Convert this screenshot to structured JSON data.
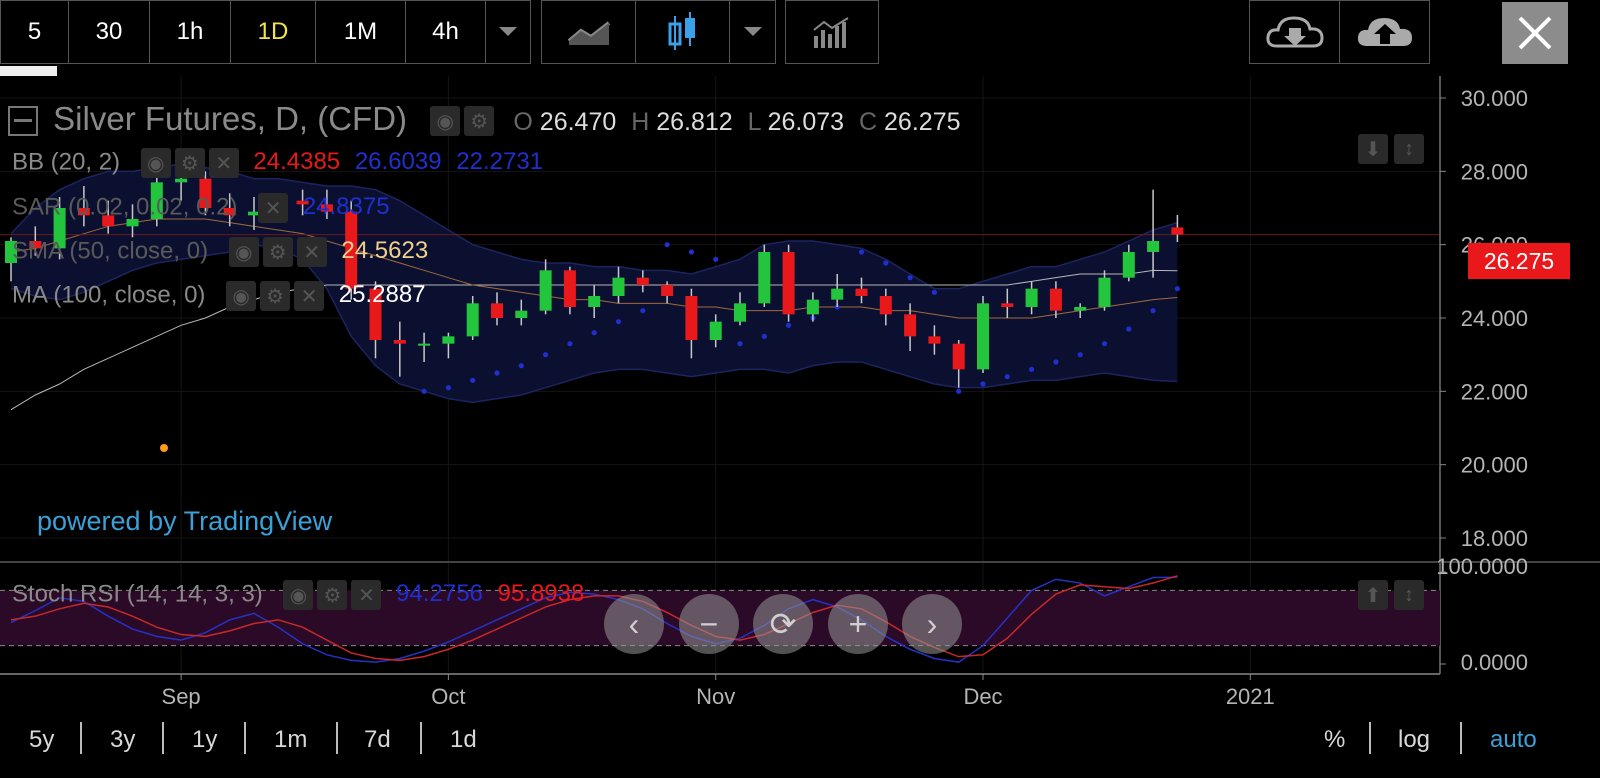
{
  "toolbar": {
    "intervals": [
      "5",
      "30",
      "1h",
      "1D",
      "1M",
      "4h"
    ],
    "active_interval": "1D",
    "chart_style_icons": [
      "line-chart-icon",
      "candlestick-icon",
      "indicators-icon"
    ],
    "cloud_download_icon": "cloud-download-icon",
    "cloud_upload_icon": "cloud-upload-icon",
    "close_icon": "close-icon"
  },
  "symbol": {
    "title": "Silver Futures, D, (CFD)",
    "o_label": "O",
    "o": "26.470",
    "h_label": "H",
    "h": "26.812",
    "l_label": "L",
    "l": "26.073",
    "c_label": "C",
    "c": "26.275"
  },
  "indicators": {
    "bb": {
      "label": "BB (20, 2)",
      "v1": "24.4385",
      "v2": "26.6039",
      "v3": "22.2731"
    },
    "sar": {
      "label": "SAR (0.02, 0.02, 0.2)",
      "v1": "24.8375"
    },
    "sma": {
      "label": "SMA (50, close, 0)",
      "v1": "24.5623"
    },
    "ma": {
      "label": "MA (100, close, 0)",
      "v1": "25.2887"
    },
    "stoch": {
      "label": "Stoch RSI (14, 14, 3, 3)",
      "v1": "94.2756",
      "v2": "95.8938"
    }
  },
  "watermark": "powered by TradingView",
  "colors": {
    "up": "#23c53d",
    "down": "#e8181b",
    "bb_fill": "#0c1030",
    "sar": "#1f2fd0",
    "stoch_fill": "#2a0a26",
    "stoch_k": "#2432c8",
    "stoch_d": "#c82828",
    "price_tag": "#e8181b",
    "sma": "#a06a3c",
    "ma": "#b8b8b8",
    "active_tf": "#f0e64c",
    "link": "#3ba0d8"
  },
  "nav_buttons": [
    "‹",
    "−",
    "⟳",
    "+",
    "›"
  ],
  "timeframes": [
    "5y",
    "3y",
    "1y",
    "1m",
    "7d",
    "1d"
  ],
  "scale_options": [
    "%",
    "log",
    "auto"
  ],
  "chart_data": {
    "type": "candlestick",
    "title": "Silver Futures, D, (CFD)",
    "ylim": [
      17.4,
      30.6
    ],
    "y_ticks": [
      "30.000",
      "28.000",
      "26.000",
      "24.000",
      "22.000",
      "20.000",
      "18.000"
    ],
    "y_tick_values": [
      30,
      28,
      26,
      24,
      22,
      20,
      18
    ],
    "x_ticks": [
      "Sep",
      "Oct",
      "Nov",
      "Dec",
      "2021"
    ],
    "x_tick_bar_index": [
      7,
      18,
      29,
      40,
      51
    ],
    "last_price": "26.275",
    "candles": [
      {
        "o": 25.5,
        "h": 26.2,
        "l": 25.0,
        "c": 26.1
      },
      {
        "o": 26.1,
        "h": 26.5,
        "l": 25.7,
        "c": 25.9
      },
      {
        "o": 25.9,
        "h": 27.3,
        "l": 25.6,
        "c": 27.0
      },
      {
        "o": 27.0,
        "h": 27.6,
        "l": 26.5,
        "c": 26.8
      },
      {
        "o": 26.8,
        "h": 27.2,
        "l": 26.3,
        "c": 26.5
      },
      {
        "o": 26.5,
        "h": 27.1,
        "l": 26.2,
        "c": 26.7
      },
      {
        "o": 26.7,
        "h": 28.0,
        "l": 26.5,
        "c": 27.7
      },
      {
        "o": 27.7,
        "h": 28.3,
        "l": 27.2,
        "c": 27.8
      },
      {
        "o": 27.8,
        "h": 28.0,
        "l": 26.8,
        "c": 27.0
      },
      {
        "o": 27.0,
        "h": 27.4,
        "l": 26.5,
        "c": 26.8
      },
      {
        "o": 26.8,
        "h": 27.3,
        "l": 26.4,
        "c": 26.9
      },
      {
        "o": 26.9,
        "h": 27.4,
        "l": 26.6,
        "c": 27.2
      },
      {
        "o": 27.2,
        "h": 27.5,
        "l": 26.8,
        "c": 27.1
      },
      {
        "o": 27.1,
        "h": 27.5,
        "l": 26.7,
        "c": 26.9
      },
      {
        "o": 26.9,
        "h": 27.2,
        "l": 24.5,
        "c": 24.8
      },
      {
        "o": 24.8,
        "h": 25.0,
        "l": 22.9,
        "c": 23.4
      },
      {
        "o": 23.4,
        "h": 23.9,
        "l": 22.4,
        "c": 23.3
      },
      {
        "o": 23.3,
        "h": 23.6,
        "l": 22.8,
        "c": 23.3
      },
      {
        "o": 23.3,
        "h": 23.6,
        "l": 22.9,
        "c": 23.5
      },
      {
        "o": 23.5,
        "h": 24.6,
        "l": 23.4,
        "c": 24.4
      },
      {
        "o": 24.4,
        "h": 24.7,
        "l": 23.8,
        "c": 24.0
      },
      {
        "o": 24.0,
        "h": 24.5,
        "l": 23.8,
        "c": 24.2
      },
      {
        "o": 24.2,
        "h": 25.6,
        "l": 24.1,
        "c": 25.3
      },
      {
        "o": 25.3,
        "h": 25.4,
        "l": 24.1,
        "c": 24.3
      },
      {
        "o": 24.3,
        "h": 24.9,
        "l": 24.0,
        "c": 24.6
      },
      {
        "o": 24.6,
        "h": 25.4,
        "l": 24.4,
        "c": 25.1
      },
      {
        "o": 25.1,
        "h": 25.3,
        "l": 24.7,
        "c": 24.9
      },
      {
        "o": 24.9,
        "h": 25.0,
        "l": 24.4,
        "c": 24.6
      },
      {
        "o": 24.6,
        "h": 24.8,
        "l": 22.9,
        "c": 23.4
      },
      {
        "o": 23.4,
        "h": 24.1,
        "l": 23.2,
        "c": 23.9
      },
      {
        "o": 23.9,
        "h": 24.7,
        "l": 23.8,
        "c": 24.4
      },
      {
        "o": 24.4,
        "h": 26.0,
        "l": 24.3,
        "c": 25.8
      },
      {
        "o": 25.8,
        "h": 26.0,
        "l": 23.9,
        "c": 24.1
      },
      {
        "o": 24.1,
        "h": 24.7,
        "l": 23.9,
        "c": 24.5
      },
      {
        "o": 24.5,
        "h": 25.2,
        "l": 24.3,
        "c": 24.8
      },
      {
        "o": 24.8,
        "h": 25.1,
        "l": 24.4,
        "c": 24.6
      },
      {
        "o": 24.6,
        "h": 24.8,
        "l": 23.8,
        "c": 24.1
      },
      {
        "o": 24.1,
        "h": 24.4,
        "l": 23.1,
        "c": 23.5
      },
      {
        "o": 23.5,
        "h": 23.8,
        "l": 23.0,
        "c": 23.3
      },
      {
        "o": 23.3,
        "h": 23.4,
        "l": 22.1,
        "c": 22.6
      },
      {
        "o": 22.6,
        "h": 24.6,
        "l": 22.5,
        "c": 24.4
      },
      {
        "o": 24.4,
        "h": 24.8,
        "l": 24.0,
        "c": 24.3
      },
      {
        "o": 24.3,
        "h": 25.0,
        "l": 24.1,
        "c": 24.8
      },
      {
        "o": 24.8,
        "h": 25.0,
        "l": 24.0,
        "c": 24.2
      },
      {
        "o": 24.2,
        "h": 24.4,
        "l": 24.0,
        "c": 24.3
      },
      {
        "o": 24.3,
        "h": 25.3,
        "l": 24.2,
        "c": 25.1
      },
      {
        "o": 25.1,
        "h": 26.0,
        "l": 25.0,
        "c": 25.8
      },
      {
        "o": 25.8,
        "h": 27.5,
        "l": 25.1,
        "c": 26.1
      },
      {
        "o": 26.47,
        "h": 26.812,
        "l": 26.073,
        "c": 26.275
      }
    ],
    "bb_upper": [
      26.3,
      27.0,
      27.5,
      27.8,
      28.0,
      28.0,
      28.1,
      28.2,
      28.1,
      28.0,
      27.8,
      27.8,
      27.7,
      27.6,
      27.6,
      27.5,
      27.2,
      26.8,
      26.4,
      26.0,
      25.8,
      25.6,
      25.5,
      25.5,
      25.4,
      25.4,
      25.3,
      25.3,
      25.2,
      25.4,
      25.6,
      26.0,
      26.1,
      26.1,
      26.0,
      25.9,
      25.6,
      25.2,
      24.8,
      24.8,
      25.0,
      25.2,
      25.4,
      25.4,
      25.6,
      25.8,
      26.1,
      26.4,
      26.6
    ],
    "bb_lower": [
      24.8,
      24.6,
      24.5,
      24.7,
      25.0,
      25.3,
      25.5,
      25.6,
      25.7,
      25.8,
      26.0,
      25.9,
      25.6,
      24.8,
      23.5,
      22.7,
      22.2,
      22.0,
      21.8,
      21.7,
      21.8,
      21.9,
      22.1,
      22.3,
      22.5,
      22.6,
      22.6,
      22.5,
      22.4,
      22.5,
      22.6,
      22.6,
      22.5,
      22.7,
      22.8,
      22.8,
      22.6,
      22.4,
      22.2,
      22.1,
      22.1,
      22.2,
      22.3,
      22.3,
      22.4,
      22.5,
      22.4,
      22.3,
      22.27
    ],
    "sma50": [
      25.8,
      25.9,
      26.1,
      26.3,
      26.5,
      26.6,
      26.7,
      26.7,
      26.7,
      26.6,
      26.5,
      26.4,
      26.3,
      26.1,
      25.9,
      25.7,
      25.5,
      25.3,
      25.1,
      24.9,
      24.8,
      24.7,
      24.6,
      24.5,
      24.5,
      24.4,
      24.4,
      24.4,
      24.3,
      24.3,
      24.2,
      24.2,
      24.2,
      24.3,
      24.3,
      24.3,
      24.2,
      24.2,
      24.1,
      24.0,
      24.0,
      24.0,
      24.0,
      24.1,
      24.2,
      24.3,
      24.4,
      24.5,
      24.56
    ],
    "ma100": [
      21.5,
      21.9,
      22.2,
      22.6,
      22.9,
      23.2,
      23.5,
      23.8,
      24.0,
      24.3,
      24.5,
      24.7,
      24.8,
      24.9,
      24.9,
      24.9,
      24.9,
      24.9,
      24.9,
      24.9,
      24.9,
      24.9,
      24.9,
      24.9,
      24.9,
      24.9,
      24.9,
      24.9,
      24.9,
      24.9,
      24.9,
      24.9,
      24.9,
      24.9,
      24.9,
      24.9,
      24.9,
      24.9,
      24.9,
      24.9,
      24.9,
      24.9,
      25.0,
      25.1,
      25.2,
      25.2,
      25.2,
      25.3,
      25.29
    ],
    "sar": [
      null,
      null,
      null,
      null,
      null,
      null,
      null,
      null,
      null,
      null,
      null,
      null,
      null,
      null,
      null,
      null,
      null,
      22.0,
      22.1,
      22.3,
      22.5,
      22.7,
      23.0,
      23.3,
      23.6,
      23.9,
      24.2,
      26.0,
      25.8,
      25.6,
      23.3,
      23.5,
      23.8,
      24.0,
      24.3,
      25.8,
      25.5,
      25.1,
      24.7,
      22.0,
      22.2,
      22.4,
      22.6,
      22.8,
      23.0,
      23.3,
      23.7,
      24.2,
      24.8
    ],
    "stoch_k": [
      45,
      58,
      72,
      68,
      52,
      38,
      30,
      26,
      34,
      48,
      55,
      40,
      22,
      10,
      4,
      2,
      6,
      14,
      24,
      36,
      48,
      60,
      72,
      78,
      76,
      70,
      60,
      44,
      30,
      22,
      28,
      42,
      60,
      70,
      62,
      48,
      30,
      16,
      6,
      2,
      20,
      50,
      80,
      92,
      88,
      74,
      84,
      94,
      94.28
    ],
    "stoch_d": [
      48,
      52,
      60,
      66,
      62,
      52,
      40,
      32,
      30,
      36,
      44,
      48,
      40,
      26,
      12,
      6,
      4,
      8,
      16,
      26,
      38,
      50,
      62,
      70,
      74,
      74,
      68,
      56,
      42,
      30,
      26,
      32,
      44,
      56,
      64,
      60,
      46,
      30,
      18,
      8,
      10,
      28,
      54,
      76,
      86,
      84,
      82,
      88,
      95.89
    ],
    "stoch_ylim": [
      0,
      100
    ],
    "stoch_y_ticks": [
      "100.0000",
      "0.0000"
    ]
  }
}
